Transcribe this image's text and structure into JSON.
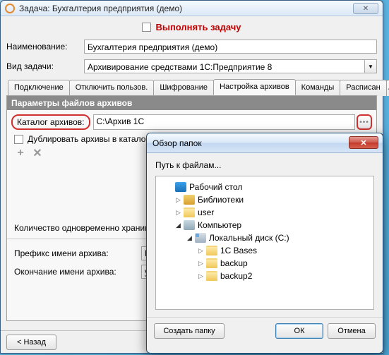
{
  "window": {
    "title": "Задача: Бухгалтерия предприятия (демо)"
  },
  "exec_checkbox_label": "Выполнять задачу",
  "form": {
    "name_label": "Наименование:",
    "name_value": "Бухгалтерия предприятия (демо)",
    "type_label": "Вид задачи:",
    "type_value": "Архивирование средствами 1С:Предприятие 8"
  },
  "tabs": {
    "t0": "Подключение",
    "t1": "Отключить пользов.",
    "t2": "Шифрование",
    "t3": "Настройка архивов",
    "t4": "Команды",
    "t5": "Расписан"
  },
  "section": {
    "params_title": "Параметры файлов архивов",
    "catalog_label": "Каталог архивов:",
    "catalog_value": "C:\\Архив 1С",
    "duplicate_label": "Дублировать архивы в катало",
    "qty_label": "Количество одновременно храним",
    "prefix_label": "Префикс имени архива:",
    "prefix_value": "Бухга",
    "suffix_label": "Окончание имени архива:",
    "suffix_value": "yyyy-"
  },
  "footer": {
    "back": "< Назад"
  },
  "dialog": {
    "title": "Обзор папок",
    "path_label": "Путь к файлам...",
    "tree": {
      "desktop": "Рабочий стол",
      "libs": "Библиотеки",
      "user": "user",
      "computer": "Компьютер",
      "disk_c": "Локальный диск (C:)",
      "f_1c": "1C Bases",
      "f_backup": "backup",
      "f_backup2": "backup2"
    },
    "btn_create": "Создать папку",
    "btn_ok": "ОК",
    "btn_cancel": "Отмена"
  }
}
